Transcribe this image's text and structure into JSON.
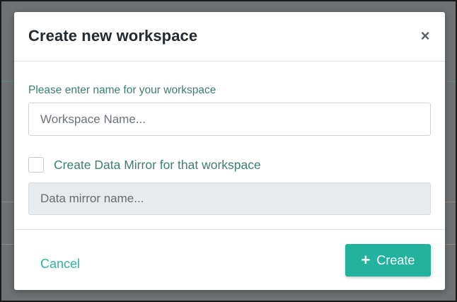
{
  "dialog": {
    "title": "Create new workspace",
    "close_glyph": "×"
  },
  "workspace": {
    "label": "Please enter name for your workspace",
    "placeholder": "Workspace Name..."
  },
  "mirror": {
    "checkbox_label": "Create Data Mirror for that workspace",
    "checked": false,
    "placeholder": "Data mirror name..."
  },
  "footer": {
    "cancel_label": "Cancel",
    "create_label": "Create",
    "create_icon": "plus-icon"
  },
  "colors": {
    "accent": "#22b29e",
    "label_text": "#3d7e73",
    "overlay": "#6f7274"
  }
}
